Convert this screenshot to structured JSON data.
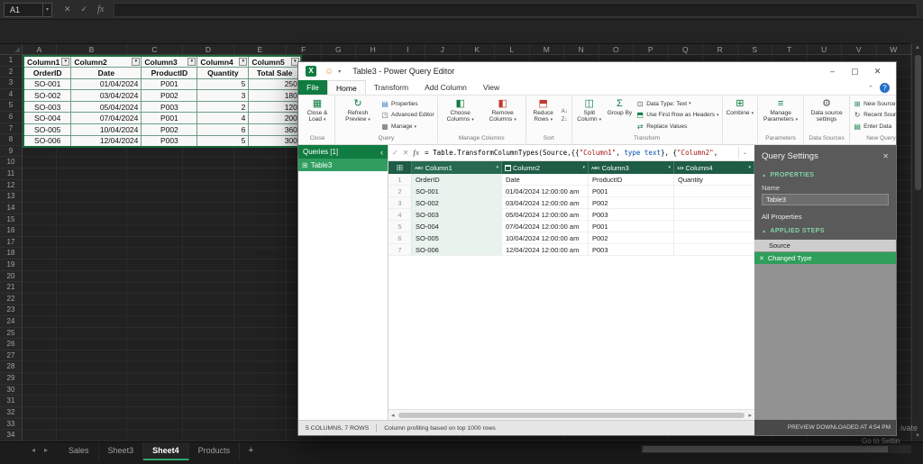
{
  "excel": {
    "name_box": "A1",
    "column_letters": [
      "A",
      "B",
      "C",
      "D",
      "E",
      "F",
      "G",
      "H",
      "I",
      "J",
      "K",
      "L",
      "M",
      "N",
      "O",
      "P",
      "Q",
      "R",
      "S",
      "T",
      "U",
      "V",
      "W"
    ],
    "row_count": 34,
    "table": {
      "filter_row": [
        "Column1",
        "Column2",
        "Column3",
        "Column4",
        "Column5"
      ],
      "header_row": [
        "OrderID",
        "Date",
        "ProductID",
        "Quantity",
        "Total Sale"
      ],
      "rows": [
        [
          "SO-001",
          "01/04/2024",
          "P001",
          "5",
          "250"
        ],
        [
          "SO-002",
          "03/04/2024",
          "P002",
          "3",
          "180"
        ],
        [
          "SO-003",
          "05/04/2024",
          "P003",
          "2",
          "120"
        ],
        [
          "SO-004",
          "07/04/2024",
          "P001",
          "4",
          "200"
        ],
        [
          "SO-005",
          "10/04/2024",
          "P002",
          "6",
          "360"
        ],
        [
          "SO-006",
          "12/04/2024",
          "P003",
          "5",
          "300"
        ]
      ]
    },
    "sheet_tabs": [
      {
        "label": "Sales",
        "active": false
      },
      {
        "label": "Sheet3",
        "active": false
      },
      {
        "label": "Sheet4",
        "active": true
      },
      {
        "label": "Products",
        "active": false
      }
    ],
    "add_sheet_label": "+",
    "watermark_line1": "ivate",
    "watermark_line2": "Go to Settin"
  },
  "pq": {
    "title": "Table3 - Power Query Editor",
    "tabs": [
      {
        "label": "File",
        "kind": "file"
      },
      {
        "label": "Home",
        "active": true
      },
      {
        "label": "Transform"
      },
      {
        "label": "Add Column"
      },
      {
        "label": "View"
      }
    ],
    "window_buttons": [
      {
        "name": "minimize-button",
        "icon": "minimize-icon"
      },
      {
        "name": "maximize-button",
        "icon": "maximize-icon"
      },
      {
        "name": "close-button",
        "icon": "close-icon"
      }
    ],
    "ribbon_groups": [
      {
        "label": "Close",
        "items": [
          {
            "kind": "big",
            "label": "Close & Load",
            "caret": true,
            "icon": "close-load-icon"
          }
        ]
      },
      {
        "label": "Query",
        "items": [
          {
            "kind": "big",
            "label": "Refresh Preview",
            "caret": true,
            "icon": "refresh-icon"
          },
          {
            "kind": "stack",
            "items": [
              {
                "label": "Properties",
                "icon": "properties-icon"
              },
              {
                "label": "Advanced Editor",
                "icon": "advanced-editor-icon"
              },
              {
                "label": "Manage",
                "caret": true,
                "icon": "manage-icon"
              }
            ]
          }
        ]
      },
      {
        "label": "Manage Columns",
        "items": [
          {
            "kind": "big",
            "label": "Choose Columns",
            "caret": true,
            "icon": "choose-columns-icon"
          },
          {
            "kind": "big",
            "label": "Remove Columns",
            "caret": true,
            "icon": "remove-columns-icon"
          }
        ]
      },
      {
        "label": "Sort",
        "items": [
          {
            "kind": "big",
            "label": "Reduce Rows",
            "caret": true,
            "icon": "reduce-rows-icon"
          },
          {
            "kind": "iconstack",
            "items": [
              {
                "icon": "sort-asc-icon"
              },
              {
                "icon": "sort-desc-icon"
              }
            ]
          }
        ]
      },
      {
        "label": "Transform",
        "items": [
          {
            "kind": "big",
            "label": "Split Column",
            "caret": true,
            "icon": "split-column-icon"
          },
          {
            "kind": "big",
            "label": "Group By",
            "icon": "group-by-icon"
          },
          {
            "kind": "stack",
            "items": [
              {
                "label": "Data Type: Text",
                "caret": true,
                "icon": "data-type-icon"
              },
              {
                "label": "Use First Row as Headers",
                "caret": true,
                "icon": "first-row-headers-icon"
              },
              {
                "label": "Replace Values",
                "icon": "replace-values-icon"
              }
            ]
          }
        ]
      },
      {
        "label": "",
        "items": [
          {
            "kind": "big",
            "label": "Combine",
            "caret": true,
            "icon": "combine-icon"
          }
        ]
      },
      {
        "label": "Parameters",
        "items": [
          {
            "kind": "big",
            "label": "Manage Parameters",
            "caret": true,
            "icon": "manage-parameters-icon"
          }
        ]
      },
      {
        "label": "Data Sources",
        "items": [
          {
            "kind": "big",
            "label": "Data source settings",
            "icon": "data-source-settings-icon"
          }
        ]
      },
      {
        "label": "New Query",
        "items": [
          {
            "kind": "stack",
            "items": [
              {
                "label": "New Source",
                "caret": true,
                "icon": "new-source-icon"
              },
              {
                "label": "Recent Sources",
                "caret": true,
                "icon": "recent-sources-icon"
              },
              {
                "label": "Enter Data",
                "icon": "enter-data-icon"
              }
            ]
          }
        ]
      }
    ],
    "queries_pane": {
      "header": "Queries [1]",
      "items": [
        {
          "label": "Table3",
          "selected": true,
          "icon": "table-icon"
        }
      ]
    },
    "formula_tokens": [
      {
        "t": "plain",
        "v": "= Table.TransformColumnTypes(Source,{{"
      },
      {
        "t": "string",
        "v": "\"Column1\""
      },
      {
        "t": "plain",
        "v": ", "
      },
      {
        "t": "keyword",
        "v": "type text"
      },
      {
        "t": "plain",
        "v": "}, {"
      },
      {
        "t": "string",
        "v": "\"Column2\""
      },
      {
        "t": "plain",
        "v": ","
      }
    ],
    "grid": {
      "columns": [
        {
          "label": "Column1",
          "type_icon": "text-type-icon",
          "selected": true
        },
        {
          "label": "Column2",
          "type_icon": "datetime-type-icon",
          "selected": false
        },
        {
          "label": "Column3",
          "type_icon": "text-type-icon",
          "selected": false
        },
        {
          "label": "Column4",
          "type_icon": "any-type-icon",
          "selected": false
        }
      ],
      "rows": [
        {
          "n": 1,
          "cells": [
            "OrderID",
            "Date",
            "ProductID",
            "Quantity"
          ]
        },
        {
          "n": 2,
          "cells": [
            "SO-001",
            "01/04/2024 12:00:00 am",
            "P001",
            ""
          ]
        },
        {
          "n": 3,
          "cells": [
            "SO-002",
            "03/04/2024 12:00:00 am",
            "P002",
            ""
          ]
        },
        {
          "n": 4,
          "cells": [
            "SO-003",
            "05/04/2024 12:00:00 am",
            "P003",
            ""
          ]
        },
        {
          "n": 5,
          "cells": [
            "SO-004",
            "07/04/2024 12:00:00 am",
            "P001",
            ""
          ]
        },
        {
          "n": 6,
          "cells": [
            "SO-005",
            "10/04/2024 12:00:00 am",
            "P002",
            ""
          ]
        },
        {
          "n": 7,
          "cells": [
            "SO-006",
            "12/04/2024 12:00:00 am",
            "P003",
            ""
          ]
        }
      ]
    },
    "status": {
      "left": "5 COLUMNS, 7 ROWS",
      "profiling": "Column profiling based on top 1000 rows",
      "right": "PREVIEW DOWNLOADED AT 4:54 PM"
    },
    "settings": {
      "title": "Query Settings",
      "properties_label": "PROPERTIES",
      "name_label": "Name",
      "name_value": "Table3",
      "all_properties": "All Properties",
      "applied_steps_label": "APPLIED STEPS",
      "steps": [
        {
          "label": "Source",
          "selected": false
        },
        {
          "label": "Changed Type",
          "selected": true
        }
      ]
    }
  }
}
